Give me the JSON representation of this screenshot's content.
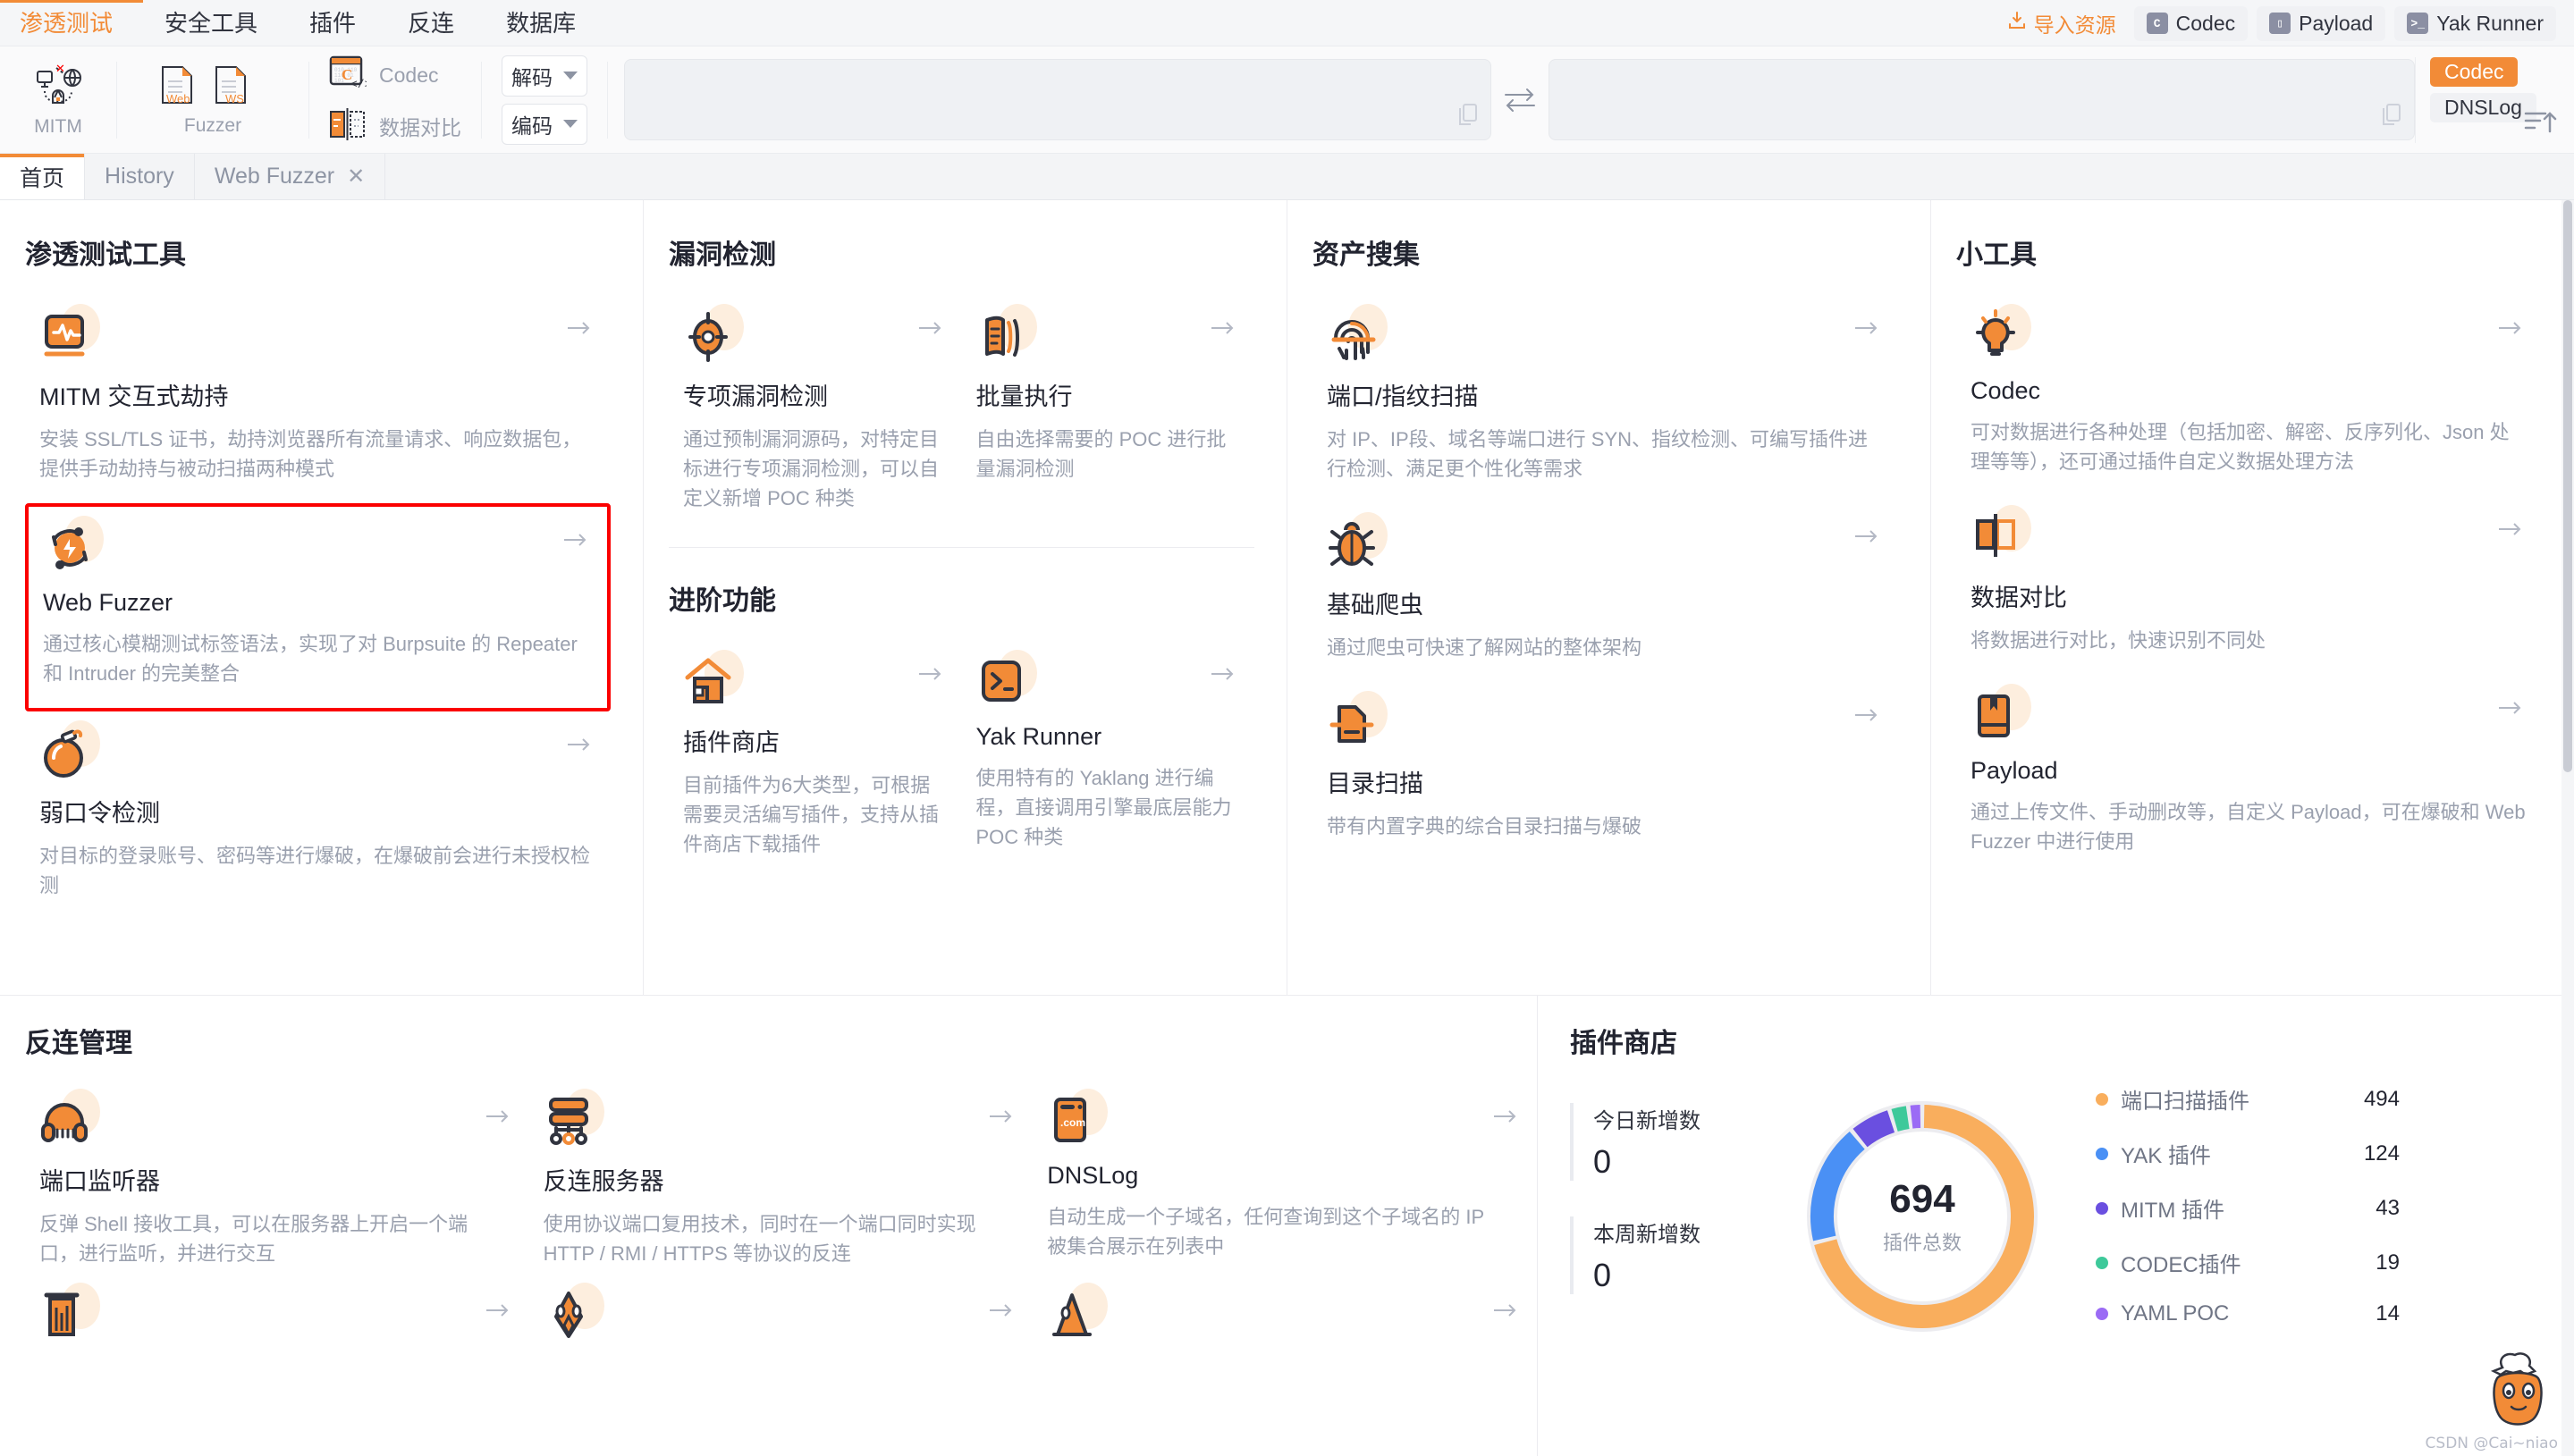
{
  "menubar": {
    "items": [
      {
        "label": "渗透测试",
        "active": true
      },
      {
        "label": "安全工具",
        "active": false
      },
      {
        "label": "插件",
        "active": false
      },
      {
        "label": "反连",
        "active": false
      },
      {
        "label": "数据库",
        "active": false
      }
    ],
    "import_label": "导入资源",
    "quick_buttons": [
      {
        "label": "Codec",
        "icon": "codec-icon"
      },
      {
        "label": "Payload",
        "icon": "payload-book-icon"
      },
      {
        "label": "Yak Runner",
        "icon": "terminal-icon"
      }
    ]
  },
  "toolstrip": {
    "mitm_label": "MITM",
    "fuzzer_label": "Fuzzer",
    "fuzzer_web_tag": "Web",
    "fuzzer_ws_tag": "WS",
    "codec_label": "Codec",
    "diff_label": "数据对比",
    "decode_select": "解码",
    "encode_select": "编码",
    "input_value": "",
    "output_value": "",
    "right_tags": [
      {
        "label": "Codec",
        "active": true
      },
      {
        "label": "DNSLog",
        "active": false
      }
    ]
  },
  "tabs": [
    {
      "label": "首页",
      "active": true,
      "closable": false
    },
    {
      "label": "History",
      "active": false,
      "closable": false
    },
    {
      "label": "Web Fuzzer",
      "active": false,
      "closable": true
    }
  ],
  "columns": [
    {
      "sections": [
        {
          "title": "渗透测试工具",
          "cards": [
            {
              "icon": "mitm-monitor-icon",
              "title": "MITM 交互式劫持",
              "desc": "安装 SSL/TLS 证书，劫持浏览器所有流量请求、响应数据包，提供手动劫持与被动扫描两种模式",
              "width": "w1",
              "highlighted": false
            },
            {
              "icon": "web-fuzzer-icon",
              "title": "Web Fuzzer",
              "desc": "通过核心模糊测试标签语法，实现了对 Burpsuite 的 Repeater 和 Intruder 的完美整合",
              "width": "w1",
              "highlighted": true
            },
            {
              "icon": "bomb-icon",
              "title": "弱口令检测",
              "desc": "对目标的登录账号、密码等进行爆破，在爆破前会进行未授权检测",
              "width": "w1",
              "highlighted": false
            }
          ]
        }
      ]
    },
    {
      "sections": [
        {
          "title": "漏洞检测",
          "cards": [
            {
              "icon": "target-icon",
              "title": "专项漏洞检测",
              "desc": "通过预制漏洞源码，对特定目标进行专项漏洞检测，可以自定义新增 POC 种类",
              "width": "w2",
              "highlighted": false
            },
            {
              "icon": "batch-exec-icon",
              "title": "批量执行",
              "desc": "自由选择需要的 POC 进行批量漏洞检测",
              "width": "w2",
              "highlighted": false
            }
          ]
        },
        {
          "title": "进阶功能",
          "cards": [
            {
              "icon": "plugin-store-icon",
              "title": "插件商店",
              "desc": "目前插件为6大类型，可根据需要灵活编写插件，支持从插件商店下载插件",
              "width": "w2",
              "highlighted": false
            },
            {
              "icon": "terminal-icon",
              "title": "Yak Runner",
              "desc": "使用特有的 Yaklang 进行编程，直接调用引擎最底层能力 POC 种类",
              "width": "w2",
              "highlighted": false
            }
          ]
        }
      ]
    },
    {
      "sections": [
        {
          "title": "资产搜集",
          "cards": [
            {
              "icon": "fingerprint-icon",
              "title": "端口/指纹扫描",
              "desc": "对 IP、IP段、域名等端口进行 SYN、指纹检测、可编写插件进行检测、满足更个性化等需求",
              "width": "w1",
              "highlighted": false
            },
            {
              "icon": "bug-icon",
              "title": "基础爬虫",
              "desc": "通过爬虫可快速了解网站的整体架构",
              "width": "w1",
              "highlighted": false
            },
            {
              "icon": "dirscan-icon",
              "title": "目录扫描",
              "desc": "带有内置字典的综合目录扫描与爆破",
              "width": "w1",
              "highlighted": false
            }
          ]
        }
      ]
    },
    {
      "sections": [
        {
          "title": "小工具",
          "cards": [
            {
              "icon": "bulb-icon",
              "title": "Codec",
              "desc": "可对数据进行各种处理（包括加密、解密、反序列化、Json 处理等等），还可通过插件自定义数据处理方法",
              "width": "w1",
              "highlighted": false
            },
            {
              "icon": "data-compare-icon",
              "title": "数据对比",
              "desc": "将数据进行对比，快速识别不同处",
              "width": "w1",
              "highlighted": false
            },
            {
              "icon": "payload-book-icon",
              "title": "Payload",
              "desc": "通过上传文件、手动删改等，自定义 Payload，可在爆破和 Web Fuzzer 中进行使用",
              "width": "w1",
              "highlighted": false
            }
          ]
        }
      ]
    }
  ],
  "reverse": {
    "title": "反连管理",
    "cards": [
      {
        "icon": "headphone-icon",
        "title": "端口监听器",
        "desc": "反弹 Shell 接收工具，可以在服务器上开启一个端口，进行监听，并进行交互"
      },
      {
        "icon": "server-icon",
        "title": "反连服务器",
        "desc": "使用协议端口复用技术，同时在一个端口同时实现 HTTP / RMI / HTTPS 等协议的反连"
      },
      {
        "icon": "dnslog-icon",
        "title": "DNSLog",
        "desc": "自动生成一个子域名，任何查询到这个子域名的 IP 被集合展示在列表中"
      },
      {
        "icon": "chart-icon",
        "title": "",
        "desc": ""
      },
      {
        "icon": "rocket-icon",
        "title": "",
        "desc": ""
      },
      {
        "icon": "cone-icon",
        "title": "",
        "desc": ""
      }
    ]
  },
  "plugin_store": {
    "title": "插件商店",
    "stats": [
      {
        "label": "今日新增数",
        "value": "0"
      },
      {
        "label": "本周新增数",
        "value": "0"
      }
    ],
    "total": "694",
    "total_label": "插件总数"
  },
  "chart_data": {
    "type": "pie",
    "title": "插件商店",
    "center_label": "插件总数",
    "center_value": 694,
    "legend_position": "right",
    "categories": [
      "端口扫描插件",
      "YAK 插件",
      "MITM 插件",
      "CODEC插件",
      "YAML POC"
    ],
    "values": [
      494,
      124,
      43,
      19,
      14
    ],
    "colors": [
      "#f9ae5d",
      "#4a90f5",
      "#6a4fe0",
      "#3ec99a",
      "#9b6bf5"
    ]
  },
  "watermark": "CSDN @Cai~niao"
}
